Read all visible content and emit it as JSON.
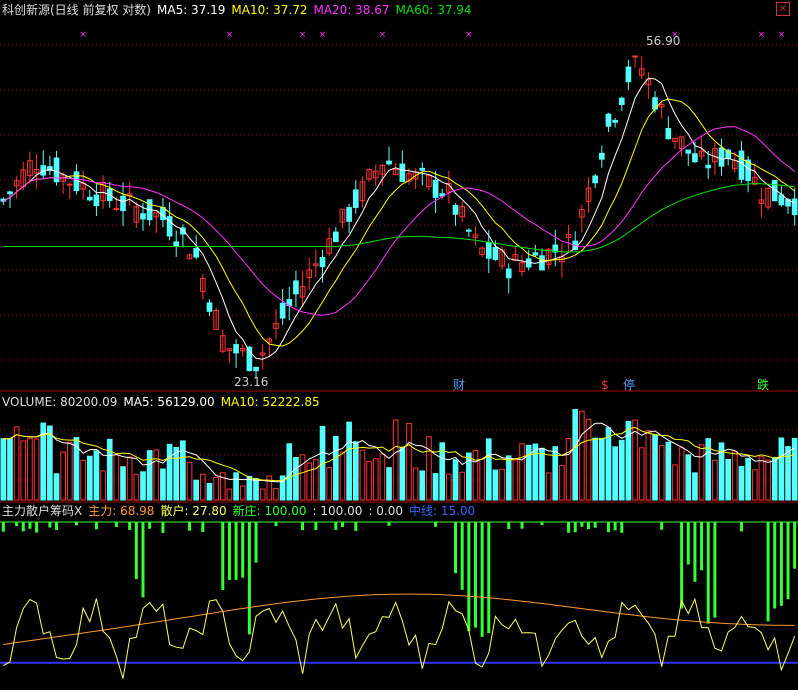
{
  "colors": {
    "up": "#ff3333",
    "down": "#54ffff",
    "ma5": "#ffffff",
    "ma10": "#ffff00",
    "ma20": "#ff33ff",
    "ma60": "#00e000",
    "main_force": "#ff9933",
    "retail": "#ffff66",
    "new_bank": "#33ff33",
    "midline": "#3333ff",
    "grid": "#8b0000"
  },
  "top_panel": {
    "title": "科创新源(日线 前复权 对数)",
    "ma5": "MA5: 37.19",
    "ma10": "MA10: 37.72",
    "ma20": "MA20: 38.67",
    "ma60": "MA60: 37.94",
    "high_label": "56.90",
    "low_label": "23.16",
    "marks": [
      "财",
      "$",
      "停",
      "跌"
    ],
    "close_icon": "×"
  },
  "volume_panel": {
    "volume": "VOLUME: 80200.09",
    "ma5": "MA5: 56129.00",
    "ma10": "MA10: 52222.85"
  },
  "indicator_panel": {
    "name": "主力散户筹码X",
    "main_force": "主力: 68.98",
    "retail": "散户: 27.80",
    "new_bank": "新庄: 100.00",
    "v1": ": 100.00",
    "v2": ": 0.00",
    "midline": "中线: 15.00"
  },
  "chart_data": [
    {
      "type": "candlestick",
      "title": "科创新源(日线 前复权 对数)",
      "series_count": 120,
      "price_range": [
        23.16,
        56.9
      ],
      "scale": "log",
      "moving_averages": [
        {
          "name": "MA5",
          "value": 37.19
        },
        {
          "name": "MA10",
          "value": 37.72
        },
        {
          "name": "MA20",
          "value": 38.67
        },
        {
          "name": "MA60",
          "value": 37.94
        }
      ],
      "annotations": [
        {
          "text": "56.90",
          "kind": "high"
        },
        {
          "text": "23.16",
          "kind": "low"
        }
      ]
    },
    {
      "type": "bar",
      "title": "VOLUME",
      "latest": 80200.09,
      "ma5": 56129.0,
      "ma10": 52222.85
    },
    {
      "type": "line",
      "title": "主力散户筹码X",
      "series": [
        {
          "name": "主力",
          "latest": 68.98
        },
        {
          "name": "散户",
          "latest": 27.8
        },
        {
          "name": "新庄",
          "latest": 100.0
        },
        {
          "name": "中线",
          "latest": 15.0
        }
      ],
      "ylim": [
        0,
        100
      ]
    }
  ]
}
